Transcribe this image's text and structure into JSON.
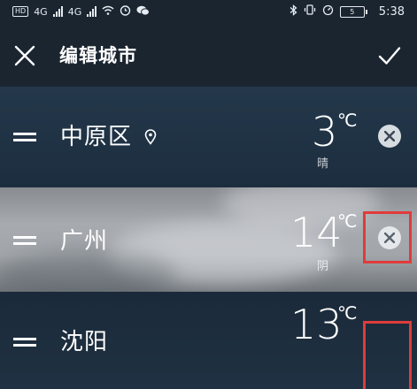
{
  "statusbar": {
    "hd": "HD",
    "net1": "4G",
    "net2": "4G",
    "battery": "5",
    "time": "5:38"
  },
  "header": {
    "title": "编辑城市"
  },
  "cities": [
    {
      "name": "中原区",
      "temp": "3",
      "unit": "℃",
      "desc": "晴",
      "located": true
    },
    {
      "name": "广州",
      "temp": "14",
      "unit": "℃",
      "desc": "阴",
      "highlighted": true
    },
    {
      "name": "沈阳",
      "temp": "13",
      "unit": "℃"
    }
  ],
  "colors": {
    "highlight": "#e03b3b",
    "header_bg": "#1a2530"
  },
  "icons": [
    "close-icon",
    "check-icon",
    "location-pin-icon",
    "drag-handle-icon",
    "delete-icon"
  ]
}
